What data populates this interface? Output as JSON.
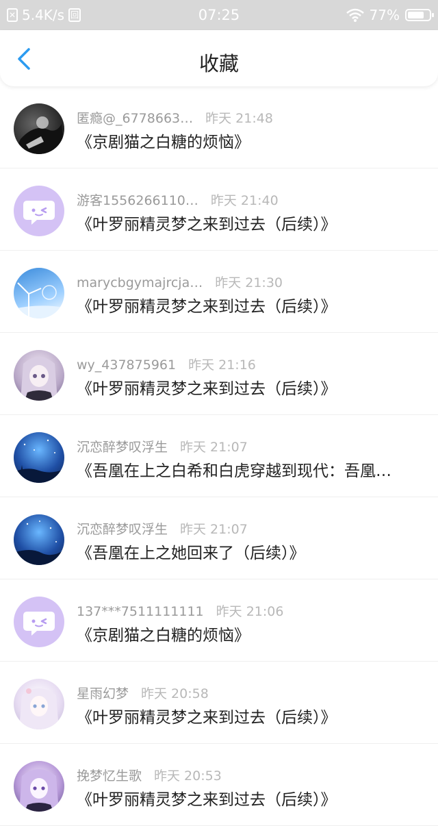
{
  "status_bar": {
    "speed": "5.4K/s",
    "time": "07:25",
    "battery": "77%",
    "battery_level": 0.77
  },
  "navbar": {
    "title": "收藏",
    "back_icon": "chevron-left-icon",
    "accent": "#2b9bf0"
  },
  "favorites": [
    {
      "user": "匿瘾@_6778663…",
      "time": "昨天 21:48",
      "title": "《京剧猫之白糖的烦恼》",
      "avatar": "dark-photo"
    },
    {
      "user": "游客1556266110…",
      "time": "昨天 21:40",
      "title": "《叶罗丽精灵梦之来到过去（后续）》",
      "avatar": "chat-bubble-icon"
    },
    {
      "user": "marycbgymajrcja…",
      "time": "昨天 21:30",
      "title": "《叶罗丽精灵梦之来到过去（后续）》",
      "avatar": "windmill-sky-photo"
    },
    {
      "user": "wy_437875961",
      "time": "昨天 21:16",
      "title": "《叶罗丽精灵梦之来到过去（后续）》",
      "avatar": "anime-girl-photo"
    },
    {
      "user": "沉恋醉梦叹浮生",
      "time": "昨天 21:07",
      "title": "《吾凰在上之白希和白虎穿越到现代：吾凰…",
      "avatar": "night-sky-photo"
    },
    {
      "user": "沉恋醉梦叹浮生",
      "time": "昨天 21:07",
      "title": "《吾凰在上之她回来了（后续）》",
      "avatar": "night-sky-photo"
    },
    {
      "user": "137***7511111111",
      "time": "昨天 21:06",
      "title": "《京剧猫之白糖的烦恼》",
      "avatar": "chat-bubble-icon"
    },
    {
      "user": "星雨幻梦",
      "time": "昨天 20:58",
      "title": "《叶罗丽精灵梦之来到过去（后续）》",
      "avatar": "pastel-anime-photo"
    },
    {
      "user": "挽梦忆生歌",
      "time": "昨天 20:53",
      "title": "《叶罗丽精灵梦之来到过去（后续）》",
      "avatar": "purple-anime-photo"
    }
  ]
}
